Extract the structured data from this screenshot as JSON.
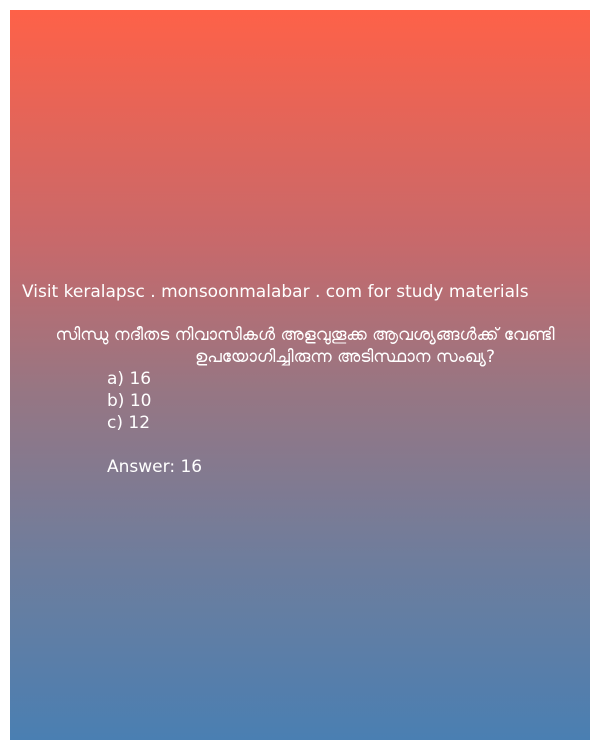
{
  "visit_text": "Visit keralapsc . monsoonmalabar . com for study materials",
  "question": "സിന്ധു നദീതട നിവാസികൾ അളവുതൂക്ക ആവശ്യങ്ങൾക്ക് വേണ്ടി ഉപയോഗിച്ചിരുന്ന അടിസ്ഥാന സംഖ്യ?",
  "options": [
    "a) 16",
    "b) 10",
    "c) 12"
  ],
  "answer": "Answer: 16",
  "colors": {
    "gradient_top": "#fe6148",
    "gradient_bottom": "#4a7fb2",
    "text": "#ffffff"
  }
}
